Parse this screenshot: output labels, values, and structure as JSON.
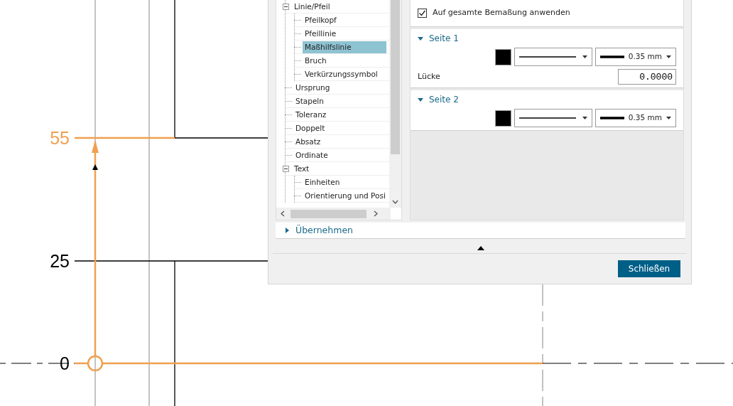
{
  "canvas": {
    "dimension_labels": [
      {
        "text": "55",
        "highlighted": true
      },
      {
        "text": "25",
        "highlighted": false
      },
      {
        "text": "0",
        "highlighted": false
      }
    ]
  },
  "dialog": {
    "tree": [
      {
        "label": "Linie/Pfeil",
        "selected": false,
        "expanded": true,
        "children": [
          {
            "label": "Pfeilkopf",
            "selected": false
          },
          {
            "label": "Pfeillinie",
            "selected": false
          },
          {
            "label": "Maßhilfslinie",
            "selected": true
          },
          {
            "label": "Bruch",
            "selected": false
          },
          {
            "label": "Verkürzungssymbol",
            "selected": false
          }
        ]
      },
      {
        "label": "Ursprung",
        "selected": false
      },
      {
        "label": "Stapeln",
        "selected": false
      },
      {
        "label": "Toleranz",
        "selected": false
      },
      {
        "label": "Doppelt",
        "selected": false
      },
      {
        "label": "Absatz",
        "selected": false
      },
      {
        "label": "Ordinate",
        "selected": false
      },
      {
        "label": "Text",
        "selected": false,
        "expanded": true,
        "children": [
          {
            "label": "Einheiten",
            "selected": false
          },
          {
            "label": "Orientierung und Posi",
            "selected": false
          }
        ]
      }
    ],
    "apply_all": {
      "label": "Auf gesamte Bemaßung anwenden",
      "checked": true
    },
    "sections": [
      {
        "title": "Seite 1",
        "expanded": true,
        "color": "#000000",
        "weight": "0.35 mm",
        "gap": {
          "label": "Lücke",
          "value": "0.0000"
        }
      },
      {
        "title": "Seite 2",
        "expanded": true,
        "color": "#000000",
        "weight": "0.35 mm"
      }
    ],
    "apply_section": {
      "title": "Übernehmen",
      "expanded": false
    },
    "close_button": "Schließen"
  }
}
